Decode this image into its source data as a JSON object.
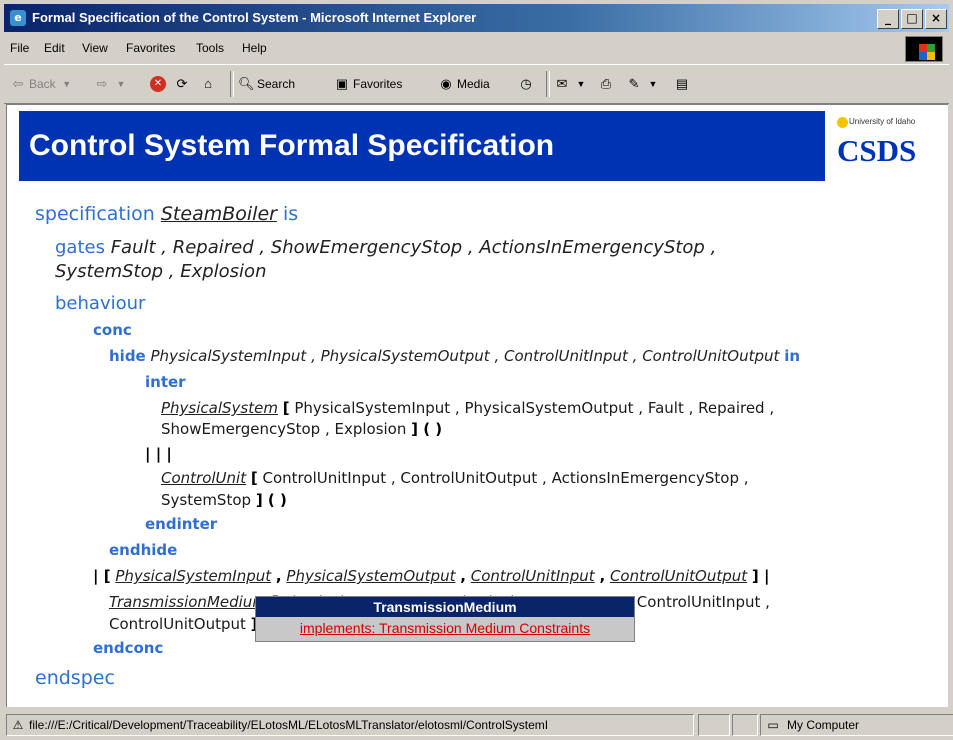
{
  "window": {
    "title": "Formal Specification of the Control System - Microsoft Internet Explorer",
    "min_btn": "_",
    "max_btn": "□",
    "close_btn": "×"
  },
  "menu": [
    "File",
    "Edit",
    "View",
    "Favorites",
    "Tools",
    "Help"
  ],
  "toolbar": {
    "back": "Back",
    "search": "Search",
    "favorites": "Favorites",
    "media": "Media"
  },
  "banner": {
    "title": "Control System Formal Specification",
    "logo_university": "University of Idaho",
    "logo_text": "CSDS"
  },
  "spec": {
    "specification_kw": "specification",
    "spec_name": "SteamBoiler",
    "is_kw": "is",
    "gates_kw": "gates",
    "gates_line1": "Fault , Repaired , ShowEmergencyStop , ActionsInEmergencyStop ,",
    "gates_line2": "SystemStop , Explosion",
    "behaviour_kw": "behaviour",
    "conc_kw": "conc",
    "hide_kw": "hide",
    "hide_list": "PhysicalSystemInput , PhysicalSystemOutput , ControlUnitInput , ControlUnitOutput",
    "in_kw": "in",
    "inter_kw": "inter",
    "physical_system": "PhysicalSystem",
    "ps_params_line1": "PhysicalSystemInput , PhysicalSystemOutput , Fault , Repaired ,",
    "ps_params_line2": "ShowEmergencyStop , Explosion",
    "lbracket": "[",
    "rbracket_call": "] ( )",
    "parallel": "| | |",
    "control_unit": "ControlUnit",
    "cu_params_line1": "ControlUnitInput , ControlUnitOutput , ActionsInEmergencyStop ,",
    "cu_params_line2": "SystemStop",
    "endinter_kw": "endinter",
    "endhide_kw": "endhide",
    "sync_open": "| [",
    "sync_g1": "PhysicalSystemInput",
    "sync_g2": "PhysicalSystemOutput",
    "sync_g3": "ControlUnitInput",
    "sync_g4": "ControlUnitOutput",
    "sync_close": "] |",
    "comma": ",",
    "transmission_medium": "TransmissionMedium",
    "tm_params_line1": "PhysicalSystemInput , PhysicalSystemOutput , ControlUnitInput ,",
    "tm_params_line2": "ControlUnitOutput",
    "endconc_kw": "endconc",
    "endspec_kw": "endspec"
  },
  "tooltip": {
    "title": "TransmissionMedium",
    "link": "implements: Transmission Medium Constraints"
  },
  "status": {
    "url": "file:///E:/Critical/Development/Traceability/ELotosML/ELotosMLTranslator/elotosml/ControlSystemI",
    "zone": "My Computer"
  },
  "colors": {
    "banner_bg": "#0032b4",
    "keyword": "#2e6fd0",
    "tooltip_link": "#d40000"
  }
}
